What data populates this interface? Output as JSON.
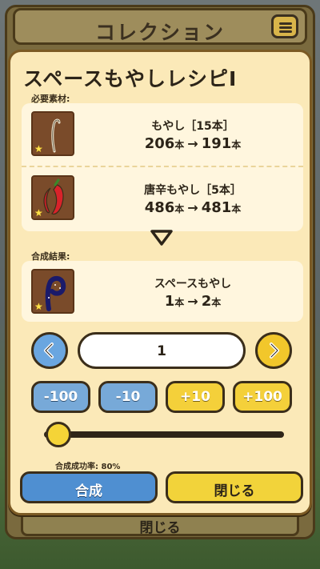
{
  "header": {
    "title": "コレクション",
    "menu_icon": "list-menu-icon"
  },
  "background": {
    "close_label": "閉じる"
  },
  "modal": {
    "title": "スペースもやしレシピI",
    "required_label": "必要素材:",
    "result_label": "合成結果:",
    "materials": [
      {
        "icon": "bean-sprout-icon",
        "name": "もやし［15本］",
        "from": "206",
        "to": "191",
        "unit": "本"
      },
      {
        "icon": "red-pepper-sprout-icon",
        "name": "唐辛もやし［5本］",
        "from": "486",
        "to": "481",
        "unit": "本"
      }
    ],
    "result": {
      "icon": "space-sprout-icon",
      "name": "スペースもやし",
      "from": "1",
      "to": "2",
      "unit": "本"
    },
    "arrow": "→",
    "quantity": "1",
    "step_buttons": [
      "-100",
      "-10",
      "+10",
      "+100"
    ],
    "slider_value": 0.0,
    "success_rate": "合成成功率: 80%",
    "craft_label": "合成",
    "close_label": "閉じる"
  },
  "colors": {
    "accent_blue": "#4f8fd1",
    "accent_yellow": "#f2d33a",
    "panel": "#fbe9b8"
  }
}
